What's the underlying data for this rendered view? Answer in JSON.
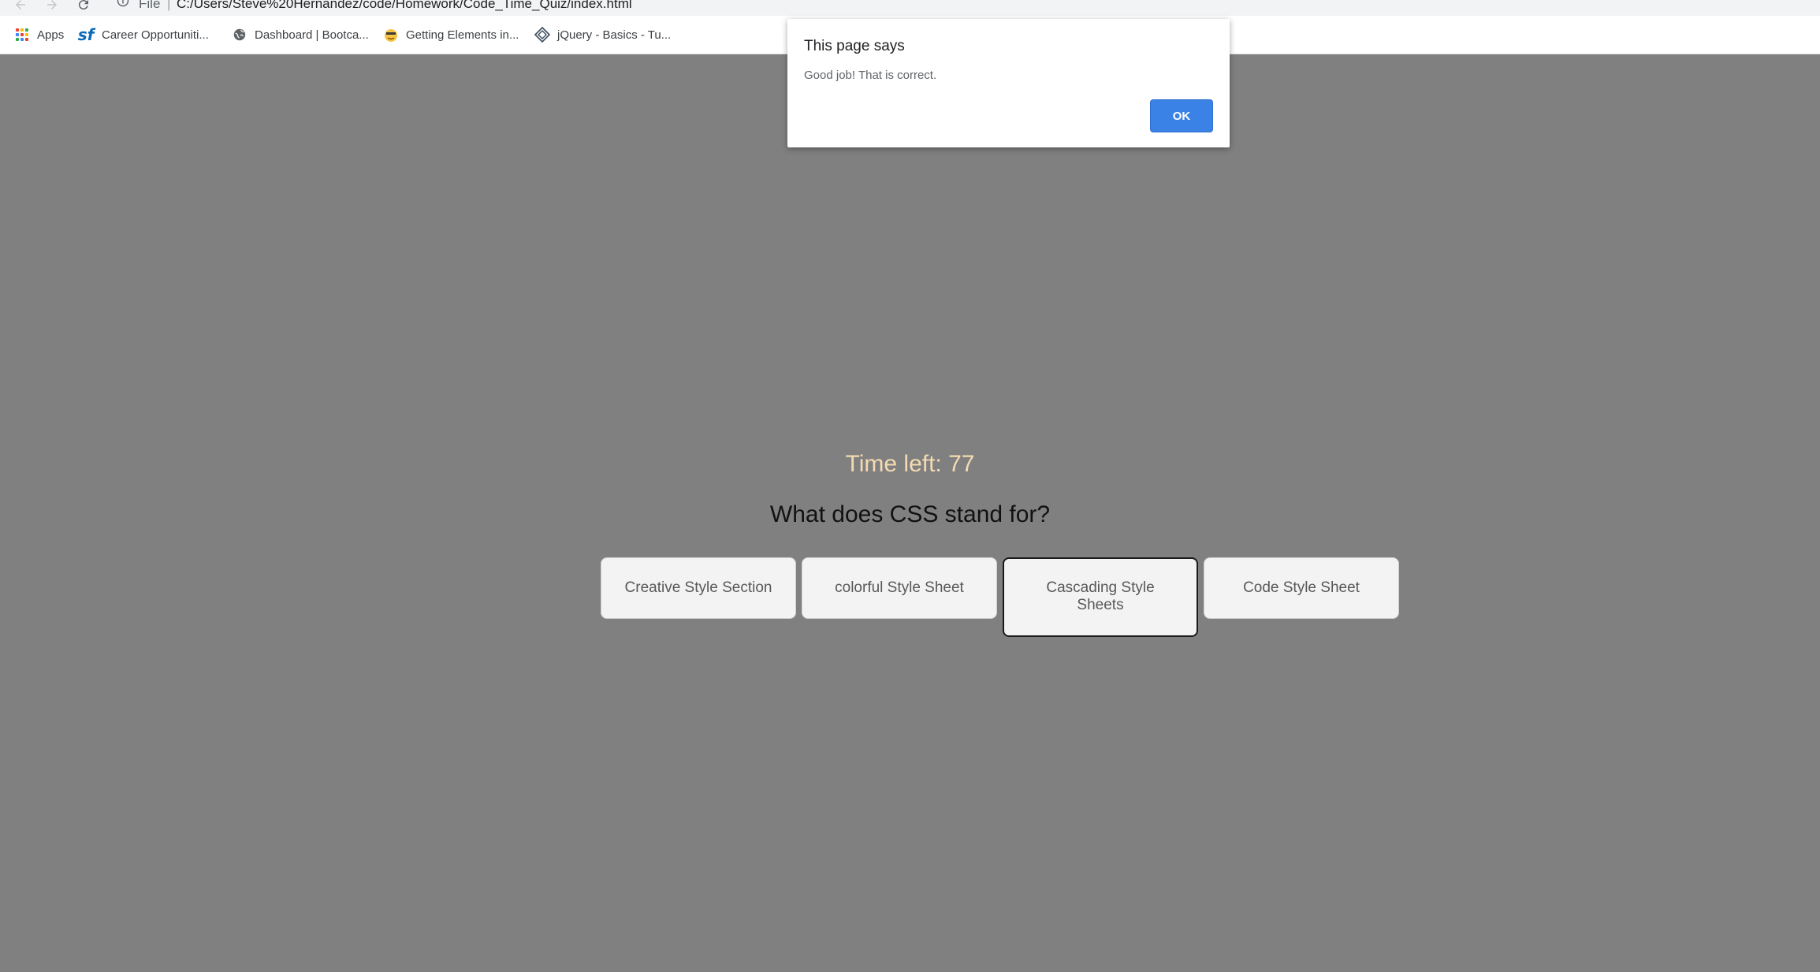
{
  "browser": {
    "scheme_label": "File",
    "separator": "|",
    "url": "C:/Users/Steve%20Hernandez/code/Homework/Code_Time_Quiz/index.html",
    "bookmarks": [
      {
        "label": "Apps",
        "icon": "apps-grid-icon"
      },
      {
        "label": "Career Opportuniti...",
        "icon": "sf-logo-icon"
      },
      {
        "label": "Dashboard | Bootca...",
        "icon": "globe-icon"
      },
      {
        "label": "Getting Elements in...",
        "icon": "bookmark-emoji-icon"
      },
      {
        "label": "jQuery - Basics - Tu...",
        "icon": "diamond-logo-icon"
      }
    ]
  },
  "quiz": {
    "timer_text": "Time left: 77",
    "question": "What does CSS stand for?",
    "answers": [
      {
        "label": "Creative Style Section",
        "selected": false
      },
      {
        "label": "colorful Style Sheet",
        "selected": false
      },
      {
        "label": "Cascading Style Sheets",
        "selected": true
      },
      {
        "label": "Code Style Sheet",
        "selected": false
      }
    ]
  },
  "alert": {
    "title": "This page says",
    "message": "Good job! That is correct.",
    "ok_label": "OK"
  },
  "colors": {
    "page_background": "#808080",
    "timer_text": "#f4dbb1",
    "answer_background": "#f3f3f3",
    "ok_button": "#3b82e6"
  }
}
